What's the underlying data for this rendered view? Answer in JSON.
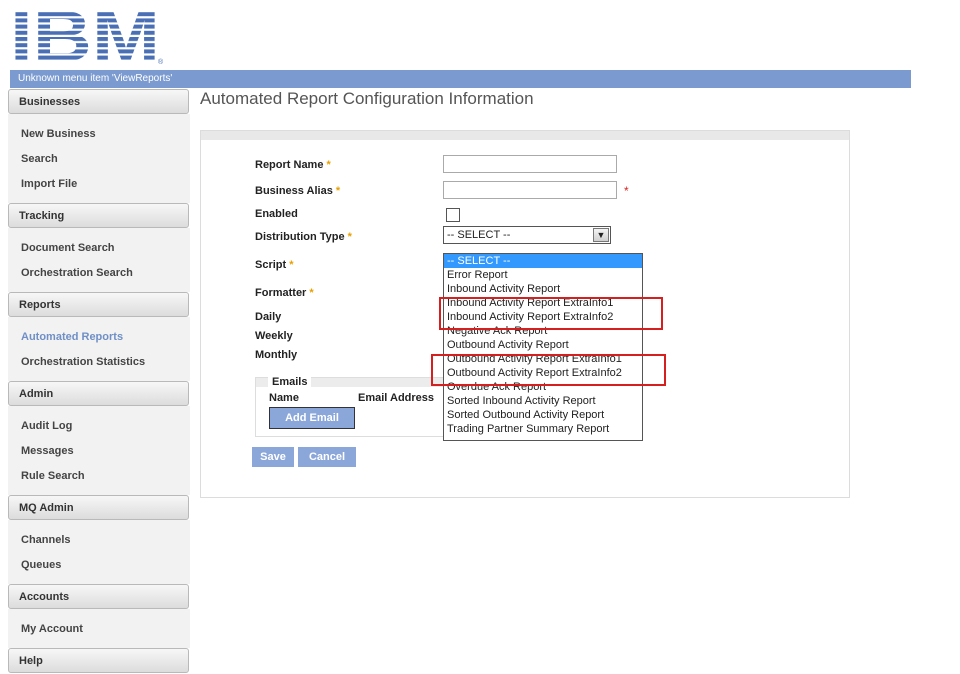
{
  "brand": {
    "logo_text": "IBM",
    "registered": "®",
    "color": "#4a6fb5"
  },
  "topbar": {
    "message": "Unknown menu item 'ViewReports'"
  },
  "sidebar": {
    "sections": [
      {
        "header": "Businesses",
        "items": [
          "New Business",
          "Search",
          "Import File"
        ]
      },
      {
        "header": "Tracking",
        "items": [
          "Document Search",
          "Orchestration Search"
        ]
      },
      {
        "header": "Reports",
        "items": [
          "Automated Reports",
          "Orchestration Statistics"
        ]
      },
      {
        "header": "Admin",
        "items": [
          "Audit Log",
          "Messages",
          "Rule Search"
        ]
      },
      {
        "header": "MQ Admin",
        "items": [
          "Channels",
          "Queues"
        ]
      },
      {
        "header": "Accounts",
        "items": [
          "My Account"
        ]
      },
      {
        "header": "Help",
        "items": []
      }
    ],
    "active_item": "Automated Reports"
  },
  "page": {
    "title": "Automated Report Configuration Information"
  },
  "form": {
    "report_name_label": "Report Name",
    "business_alias_label": "Business Alias",
    "enabled_label": "Enabled",
    "distribution_type_label": "Distribution Type",
    "script_label": "Script",
    "formatter_label": "Formatter",
    "daily_label": "Daily",
    "weekly_label": "Weekly",
    "monthly_label": "Monthly",
    "required_marker": "*",
    "report_name_value": "",
    "business_alias_value": "",
    "distribution_type_selected": "-- SELECT --"
  },
  "script_dropdown": {
    "options": [
      "-- SELECT --",
      "Error Report",
      "Inbound Activity Report",
      "Inbound Activity Report ExtraInfo1",
      "Inbound Activity Report ExtraInfo2",
      "Negative Ack Report",
      "Outbound Activity Report",
      "Outbound Activity Report ExtraInfo1",
      "Outbound Activity Report ExtraInfo2",
      "Overdue Ack Report",
      "Sorted Inbound Activity Report",
      "Sorted Outbound Activity Report",
      "Trading Partner Summary Report"
    ],
    "selected": "-- SELECT --",
    "highlight_color": "#d62020"
  },
  "emails": {
    "legend": "Emails",
    "col_name": "Name",
    "col_address": "Email Address",
    "add_label": "Add Email"
  },
  "actions": {
    "save_label": "Save",
    "cancel_label": "Cancel"
  }
}
